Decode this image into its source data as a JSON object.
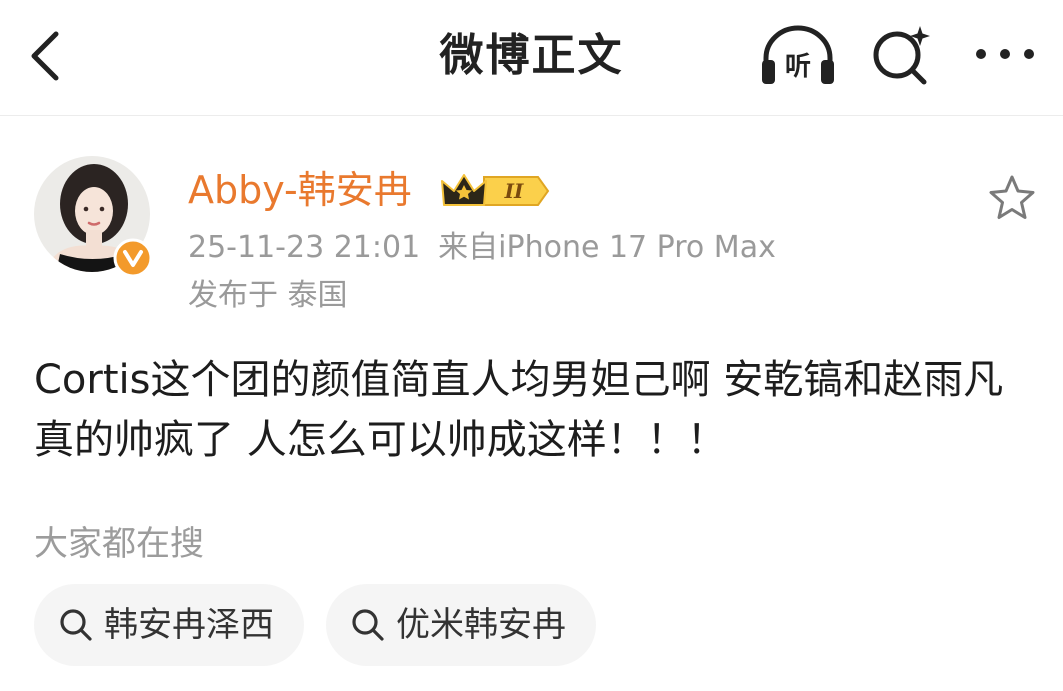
{
  "nav": {
    "title": "微博正文",
    "back_icon": "chevron-left-icon",
    "listen_label": "听",
    "listen_icon": "headphones-icon",
    "search_icon": "search-sparkle-icon",
    "more_icon": "more-dots-icon"
  },
  "post": {
    "author": {
      "name": "Abby-韩安冉",
      "avatar_icon": "avatar",
      "verified_icon": "verified-v-icon",
      "vip_badge_icon": "crown-icon",
      "vip_level": "II"
    },
    "timestamp": "25-11-23 21:01",
    "source": "来自iPhone 17 Pro Max",
    "location": "发布于 泰国",
    "text": "Cortis这个团的颜值简直人均男妲己啊 安乾镐和赵雨凡真的帅疯了 人怎么可以帅成这样！！！",
    "favorite_icon": "star-outline-icon"
  },
  "trending": {
    "label": "大家都在搜",
    "items": [
      {
        "label": "韩安冉泽西",
        "icon": "search-icon"
      },
      {
        "label": "优米韩安冉",
        "icon": "search-icon"
      }
    ]
  },
  "colors": {
    "accent_orange": "#e9792e",
    "meta_gray": "#9a9a9a",
    "chip_background": "#f5f5f5",
    "vip_gold": "#f4c23a"
  }
}
